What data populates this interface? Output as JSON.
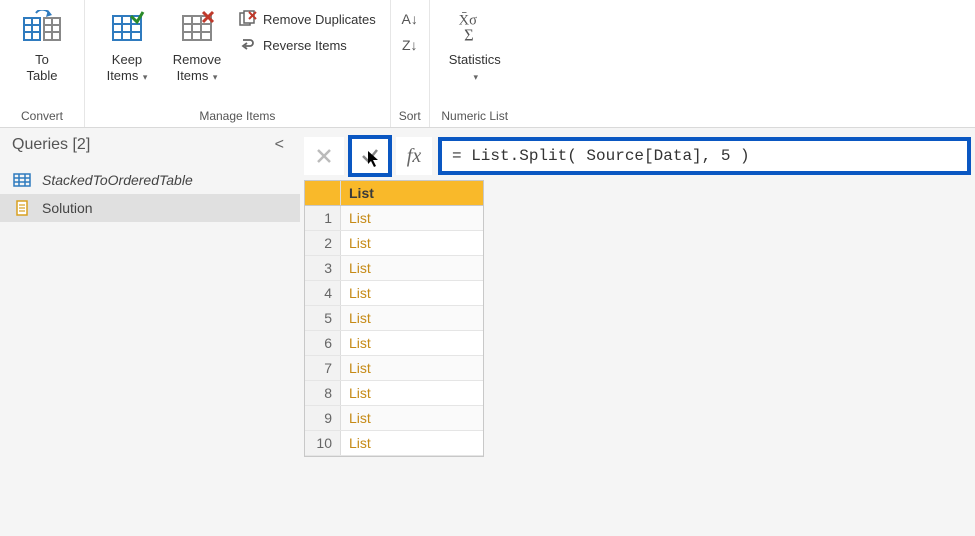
{
  "ribbon": {
    "convert": {
      "group_label": "Convert",
      "to_table_label": "To\nTable"
    },
    "manage_items": {
      "group_label": "Manage Items",
      "keep_items_label": "Keep\nItems",
      "remove_items_label": "Remove\nItems",
      "remove_duplicates_label": "Remove Duplicates",
      "reverse_items_label": "Reverse Items"
    },
    "sort": {
      "group_label": "Sort"
    },
    "numeric_list": {
      "group_label": "Numeric List",
      "statistics_label": "Statistics"
    }
  },
  "queries_pane": {
    "title": "Queries [2]",
    "items": [
      {
        "label": "StackedToOrderedTable",
        "italic": true,
        "selected": false
      },
      {
        "label": "Solution",
        "italic": false,
        "selected": true
      }
    ]
  },
  "formula_bar": {
    "fx_label": "fx",
    "value": "= List.Split( Source[Data], 5 )"
  },
  "data": {
    "column_header": "List",
    "rows": [
      {
        "n": "1",
        "v": "List"
      },
      {
        "n": "2",
        "v": "List"
      },
      {
        "n": "3",
        "v": "List"
      },
      {
        "n": "4",
        "v": "List"
      },
      {
        "n": "5",
        "v": "List"
      },
      {
        "n": "6",
        "v": "List"
      },
      {
        "n": "7",
        "v": "List"
      },
      {
        "n": "8",
        "v": "List"
      },
      {
        "n": "9",
        "v": "List"
      },
      {
        "n": "10",
        "v": "List"
      }
    ]
  }
}
